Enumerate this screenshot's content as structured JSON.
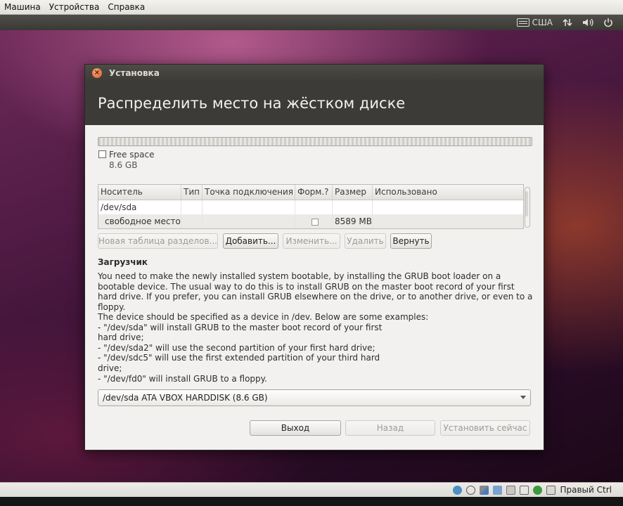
{
  "host": {
    "menu": [
      "Машина",
      "Устройства",
      "Справка"
    ],
    "status_host_key": "Правый Ctrl"
  },
  "panel": {
    "keyboard_layout": "США"
  },
  "window": {
    "title": "Установка",
    "heading": "Распределить место на жёстком диске"
  },
  "partition_bar": {
    "legend_label": "Free space",
    "legend_size": "8.6 GB"
  },
  "table": {
    "columns": [
      "Носитель",
      "Тип",
      "Точка подключения",
      "Форм.?",
      "Размер",
      "Использовано"
    ],
    "rows": [
      {
        "device": "/dev/sda",
        "type": "",
        "mount": "",
        "format": "",
        "size": "",
        "used": ""
      },
      {
        "device": "свободное место",
        "type": "",
        "mount": "",
        "format": "unchecked",
        "size": "8589 MB",
        "used": ""
      }
    ]
  },
  "partition_buttons": {
    "new_table": "Новая таблица разделов...",
    "add": "Добавить...",
    "change": "Изменить...",
    "delete": "Удалить",
    "revert": "Вернуть"
  },
  "bootloader": {
    "title": "Загрузчик",
    "para1": "You need to make the newly installed system bootable, by installing the GRUB boot loader on a bootable device. The usual way to do this is to install GRUB on the master boot record of your first hard drive. If you prefer, you can install GRUB elsewhere on the drive, or to another drive, or even to a floppy.",
    "para2": "The device should be specified as a device in /dev. Below are some examples:\n - \"/dev/sda\" will install GRUB to the master boot record of your first\n   hard drive;\n - \"/dev/sda2\" will use the second partition of your first hard drive;\n - \"/dev/sdc5\" will use the first extended partition of your third hard\n   drive;\n - \"/dev/fd0\" will install GRUB to a floppy.",
    "device_selected": "/dev/sda ATA VBOX HARDDISK (8.6 GB)"
  },
  "nav": {
    "quit": "Выход",
    "back": "Назад",
    "install": "Установить сейчас"
  }
}
